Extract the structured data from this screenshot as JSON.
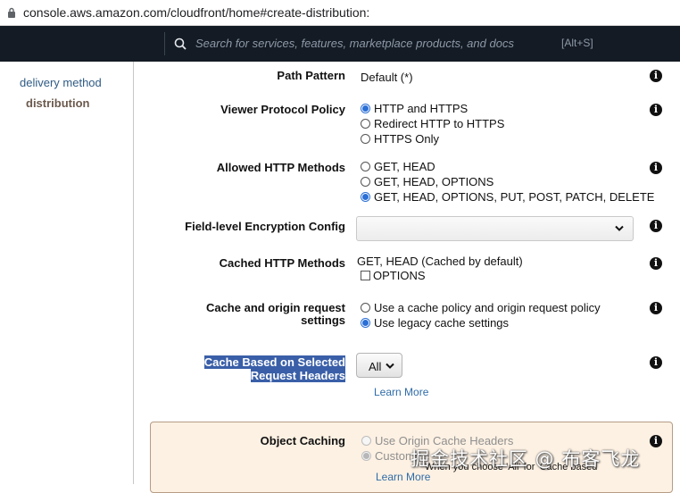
{
  "browser": {
    "url": "console.aws.amazon.com/cloudfront/home#create-distribution:"
  },
  "topnav": {
    "search_placeholder": "Search for services, features, marketplace products, and docs",
    "search_shortcut": "[Alt+S]"
  },
  "sidebar": {
    "items": [
      {
        "label": "delivery method",
        "active": false
      },
      {
        "label": "distribution",
        "active": true
      }
    ]
  },
  "form": {
    "path_pattern": {
      "label": "Path Pattern",
      "value": "Default (*)"
    },
    "viewer_protocol_policy": {
      "label": "Viewer Protocol Policy",
      "options": [
        "HTTP and HTTPS",
        "Redirect HTTP to HTTPS",
        "HTTPS Only"
      ],
      "selected": "HTTP and HTTPS"
    },
    "allowed_http_methods": {
      "label": "Allowed HTTP Methods",
      "options": [
        "GET, HEAD",
        "GET, HEAD, OPTIONS",
        "GET, HEAD, OPTIONS, PUT, POST, PATCH, DELETE"
      ],
      "selected": "GET, HEAD, OPTIONS, PUT, POST, PATCH, DELETE"
    },
    "field_level_encryption": {
      "label": "Field-level Encryption Config",
      "value": ""
    },
    "cached_http_methods": {
      "label": "Cached HTTP Methods",
      "value": "GET, HEAD (Cached by default)",
      "checkbox_label": "OPTIONS",
      "checked": false
    },
    "cache_origin_request": {
      "label_line1": "Cache and origin request",
      "label_line2": "settings",
      "options": [
        "Use a cache policy and origin request policy",
        "Use legacy cache settings"
      ],
      "selected": "Use legacy cache settings"
    },
    "cache_based_headers": {
      "label_line1": "Cache Based on Selected",
      "label_line2": "Request Headers",
      "button": "All",
      "learn_more": "Learn More"
    },
    "object_caching": {
      "label": "Object Caching",
      "options": [
        "Use Origin Cache Headers",
        "Customize"
      ],
      "selected": "Customize",
      "note": "When you choose 'All' for 'Cache based",
      "learn_more": "Learn More"
    }
  },
  "watermark": "掘金技术社区 @ 布客飞龙",
  "colors": {
    "nav_bg": "#141b24",
    "highlight": "#3a5fa8",
    "link": "#2f6ca8",
    "panel_bg": "#fdf1e3",
    "radio_accent": "#2a6fd6"
  }
}
